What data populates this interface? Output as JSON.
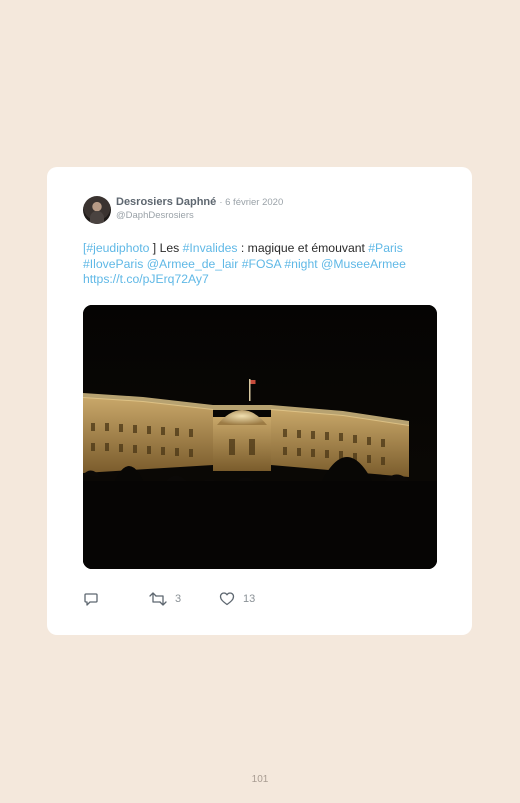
{
  "tweet": {
    "author_name": "Desrosiers Daphné",
    "date": "· 6 février 2020",
    "handle": "@DaphDesrosiers",
    "text_parts": {
      "open_bracket": "[",
      "hashtag_jeudiphoto": "#jeudiphoto",
      "close_les": " ] Les ",
      "hashtag_invalides": "#Invalides",
      "middle": " : magique et émouvant ",
      "hashtag_paris": "#Paris",
      "hashtag_iloveparis": "#IloveParis",
      "mention_armee_de_lair": "@Armee_de_lair",
      "hashtag_fosa": "#FOSA",
      "hashtag_night": "#night",
      "mention_museearmee": "@MuseeArmee",
      "url": "https://t.co/pJErq72Ay7"
    },
    "photo": {
      "description_icon": "night-building-photo"
    },
    "actions": {
      "reply_icon": "reply-icon",
      "retweet_icon": "retweet-icon",
      "retweet_count": "3",
      "like_icon": "heart-icon",
      "like_count": "13"
    }
  },
  "page_number": "101",
  "colors": {
    "background": "#f4e8dc",
    "card": "#ffffff",
    "link": "#5fb8e6",
    "meta": "#9aa2a8"
  }
}
